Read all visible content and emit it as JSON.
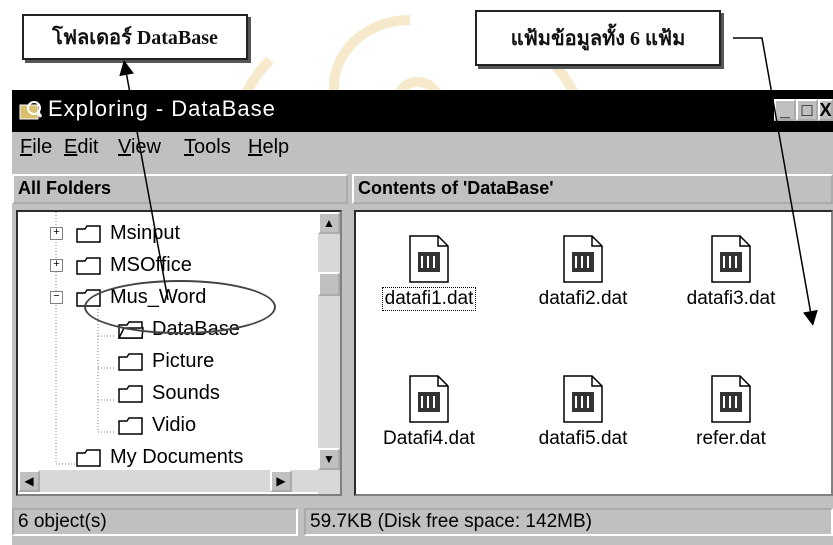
{
  "callouts": {
    "folder_label": "โฟลเดอร์ DataBase",
    "files_label": "แฟ้มข้อมูลทั้ง 6 แฟ้ม"
  },
  "window": {
    "title": "Exploring - DataBase",
    "buttons": {
      "minimize": "_",
      "maximize": "□",
      "close": "X"
    }
  },
  "menu": [
    {
      "label": "File",
      "key": "F",
      "rest": "ile"
    },
    {
      "label": "Edit",
      "key": "E",
      "rest": "dit"
    },
    {
      "label": "View",
      "key": "V",
      "rest": "iew"
    },
    {
      "label": "Tools",
      "key": "T",
      "rest": "ools"
    },
    {
      "label": "Help",
      "key": "H",
      "rest": "elp"
    }
  ],
  "left_pane": {
    "header": "All Folders",
    "tree": [
      {
        "label": "Msinput",
        "expander": "+"
      },
      {
        "label": "MSOffice",
        "expander": "+"
      },
      {
        "label": "Mus_Word",
        "expander": "−"
      },
      {
        "label": "DataBase",
        "expander": ""
      },
      {
        "label": "Picture",
        "expander": ""
      },
      {
        "label": "Sounds",
        "expander": ""
      },
      {
        "label": "Vidio",
        "expander": ""
      },
      {
        "label": "My Documents",
        "expander": ""
      }
    ]
  },
  "right_pane": {
    "header": "Contents of 'DataBase'",
    "files": [
      {
        "name": "datafi1.dat",
        "selected": true
      },
      {
        "name": "datafi2.dat",
        "selected": false
      },
      {
        "name": "datafi3.dat",
        "selected": false
      },
      {
        "name": "Datafi4.dat",
        "selected": false
      },
      {
        "name": "datafi5.dat",
        "selected": false
      },
      {
        "name": "refer.dat",
        "selected": false
      }
    ]
  },
  "status": {
    "objects": "6 object(s)",
    "size": "59.7KB (Disk free space: 142MB)"
  }
}
